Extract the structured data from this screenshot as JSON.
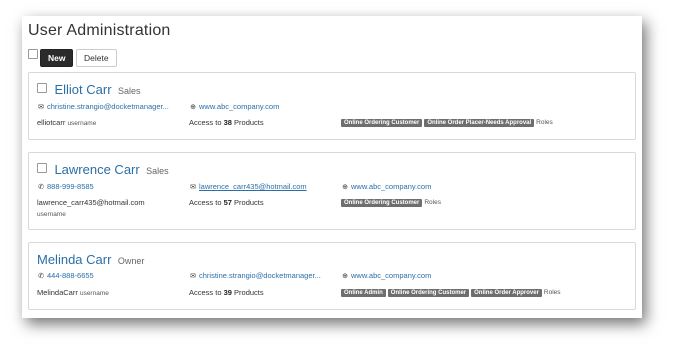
{
  "title": "User Administration",
  "toolbar": {
    "new_label": "New",
    "delete_label": "Delete"
  },
  "users": [
    {
      "name": "Elliot Carr",
      "role": "Sales",
      "has_checkbox": true,
      "email": "christine.strangio@docketmanager...",
      "website": "www.abc_company.com",
      "username": "elliotcarr",
      "username_label": "username",
      "access_prefix": "Access to",
      "products": "38",
      "products_suffix": "Products",
      "roles": [
        "Online Ordering Customer",
        "Online Order Placer-Needs Approval"
      ],
      "roles_label": "Roles"
    },
    {
      "name": "Lawrence Carr",
      "role": "Sales",
      "has_checkbox": true,
      "phone": "888-999-8585",
      "email": "lawrence_carr435@hotmail.com",
      "website": "www.abc_company.com",
      "username": "lawrence_carr435@hotmail.com",
      "username_label": "username",
      "access_prefix": "Access to",
      "products": "57",
      "products_suffix": "Products",
      "roles": [
        "Online Ordering Customer"
      ],
      "roles_label": "Roles"
    },
    {
      "name": "Melinda Carr",
      "role": "Owner",
      "has_checkbox": false,
      "phone": "444-888-6655",
      "email": "christine.strangio@docketmanager...",
      "website": "www.abc_company.com",
      "username": "MelindaCarr",
      "username_label": "username",
      "access_prefix": "Access to",
      "products": "39",
      "products_suffix": "Products",
      "roles": [
        "Online Admin",
        "Online Ordering Customer",
        "Online Order Approver"
      ],
      "roles_label": "Roles"
    }
  ],
  "icons": {
    "email": "envelope-icon",
    "phone": "phone-icon",
    "web": "globe-icon"
  }
}
